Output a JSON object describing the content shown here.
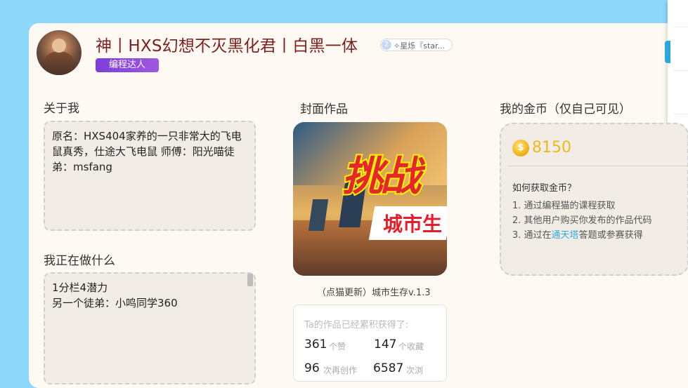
{
  "profile": {
    "name": "神丨HXS幻想不灭黑化君丨白黑一体",
    "level_badge": "2",
    "follow_text": "✧星烁『star...",
    "role_tag": "编程达人"
  },
  "about": {
    "title": "关于我",
    "text": "原名：HXS404家养的一只非常大的飞电鼠真秀，仕途大飞电鼠 师傅：阳光喵徒弟：msfang"
  },
  "doing": {
    "title": "我正在做什么",
    "line1": "1分栏4潜力",
    "line2": "另一个徒弟：小鸣同学360"
  },
  "cover": {
    "title": "封面作品",
    "image_text_main": "挑战",
    "image_text_sub": "城市生",
    "caption": "（点猫更新）城市生存v.1.3"
  },
  "stats": {
    "header": "Ta的作品已经累积获得了:",
    "likes": "361",
    "likes_label": "个赞",
    "favorites": "147",
    "favorites_label": "个收藏",
    "remixes": "96",
    "remixes_label": "次再创作",
    "views": "6587",
    "views_label": "次浏"
  },
  "coins": {
    "title": "我的金币（仅自己可见）",
    "icon_symbol": "$",
    "amount": "8150",
    "how_title": "如何获取金币？",
    "item1": "1. 通过编程猫的课程获取",
    "item2": "2. 其他用户购买你发布的作品代码",
    "item3_pre": "3. 通过在",
    "item3_link": "通天塔",
    "item3_post": "答题或参赛获得"
  },
  "colors": {
    "page_bg": "#8ed8fb",
    "card_bg": "#fef9f2",
    "name_color": "#7d1f1f",
    "tag_purple": "#7a3fd8",
    "coin_gold": "#f1b81b",
    "link_blue": "#34a7e0"
  }
}
